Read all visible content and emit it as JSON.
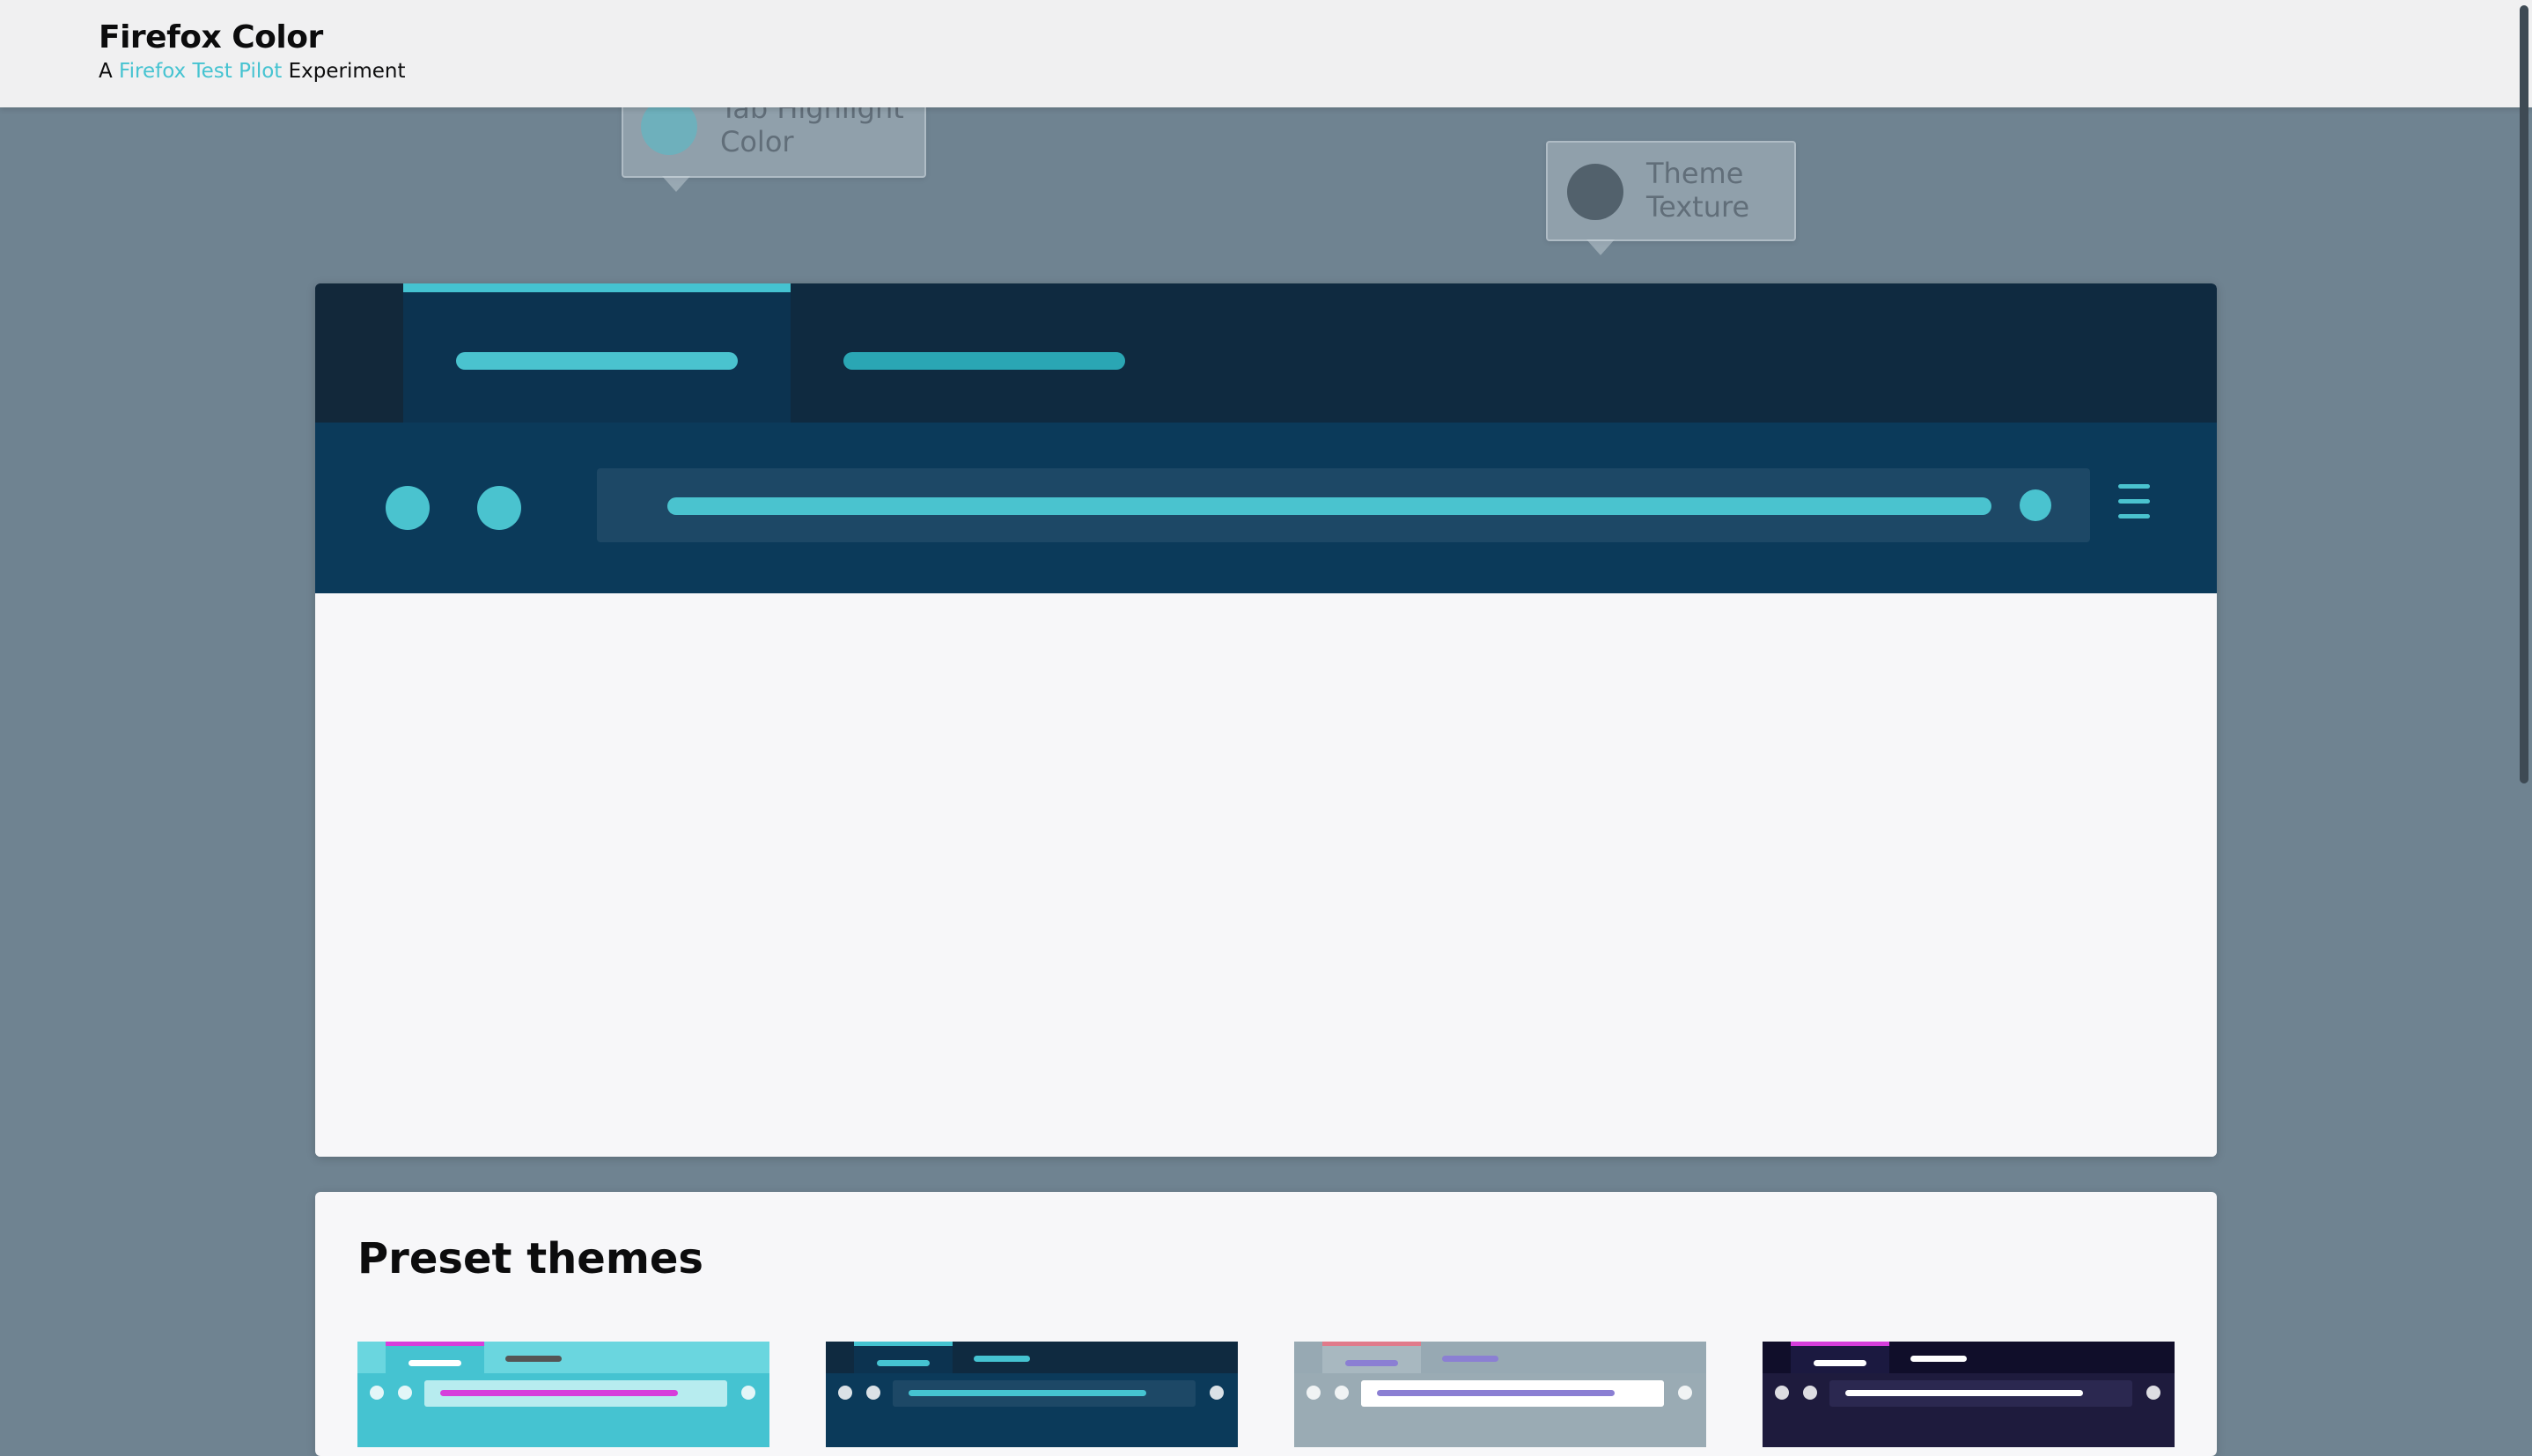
{
  "app": {
    "title": "Firefox Color",
    "subtitle_prefix": "A ",
    "subtitle_link": "Firefox Test Pilot",
    "subtitle_suffix": " Experiment"
  },
  "tooltips": [
    {
      "line1": "Tab Highlight",
      "line2": "Color",
      "dot_color": "#45c3d1"
    },
    {
      "line1": "Theme",
      "line2": "Texture",
      "dot_color": "#3d4c57"
    }
  ],
  "preview": {
    "frame_color": "#0f2a40",
    "tab_highlight_color": "#45c3d1",
    "toolbar_color": "#0b3a5a",
    "accent_color": "#4ac3cf",
    "icons": [
      "back-button-icon",
      "forward-button-icon",
      "hamburger-menu-icon"
    ]
  },
  "presets": {
    "title": "Preset themes",
    "themes": [
      {
        "frame": "#6ad6df",
        "tab": "#45c3d1",
        "highlight": "#d63edb",
        "toolbar": "#45c3d1",
        "url": "#b7ecef",
        "line": "#d63edb"
      },
      {
        "frame": "#0f2a40",
        "tab": "#0c3350",
        "highlight": "#45c3d1",
        "toolbar": "#0b3a5a",
        "url": "#1d4866",
        "line": "#45c3d1"
      },
      {
        "frame": "#97a9b3",
        "tab": "#a8b8c0",
        "highlight": "#e07a8a",
        "toolbar": "#9aabb4",
        "url": "#ffffff",
        "line": "#8b7fd3"
      },
      {
        "frame": "#100e2a",
        "tab": "#1b1940",
        "highlight": "#d63edb",
        "toolbar": "#1e1b3d",
        "url": "#2b2850",
        "line": "#ffffff"
      }
    ]
  }
}
